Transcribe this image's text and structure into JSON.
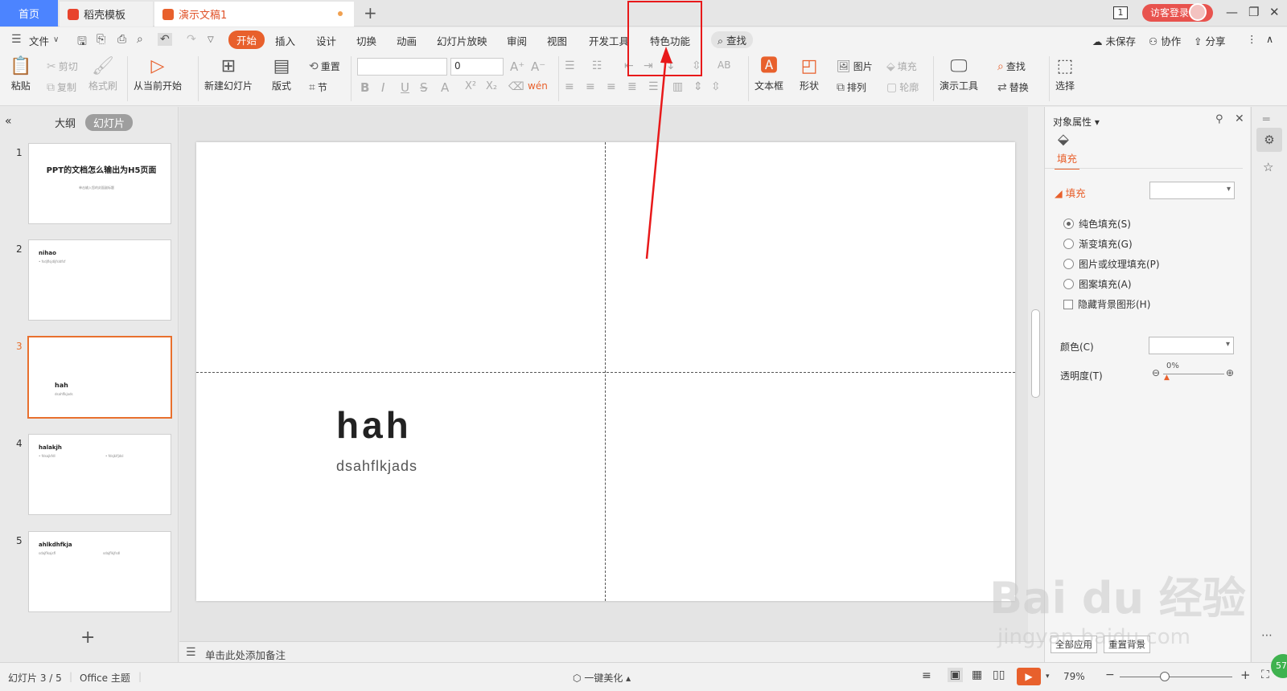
{
  "tabs": {
    "home": "首页",
    "template": "稻壳模板",
    "document": "演示文稿1",
    "new_tab": "+"
  },
  "window": {
    "slide_count_badge": "1",
    "login": "访客登录",
    "minimize": "—",
    "maximize": "❐",
    "close": "✕"
  },
  "menu": {
    "file": "文件",
    "items": [
      "开始",
      "插入",
      "设计",
      "切换",
      "动画",
      "幻灯片放映",
      "审阅",
      "视图",
      "开发工具",
      "特色功能"
    ],
    "active_index": 0,
    "search": "查找",
    "unsaved": "未保存",
    "collab": "协作",
    "share": "分享"
  },
  "ribbon": {
    "paste": "粘贴",
    "cut": "剪切",
    "copy": "复制",
    "format_painter": "格式刷",
    "from_current": "从当前开始",
    "new_slide": "新建幻灯片",
    "layout": "版式",
    "reset": "重置",
    "section": "节",
    "font_size_value": "0",
    "textbox": "文本框",
    "shape": "形状",
    "picture": "图片",
    "fill": "填充",
    "arrange": "排列",
    "outline": "轮廓",
    "present_tools": "演示工具",
    "find": "查找",
    "replace": "替换",
    "select": "选择"
  },
  "left_panel": {
    "tab_outline": "大纲",
    "tab_slides": "幻灯片",
    "slides": [
      {
        "num": "1",
        "title": "PPT的文档怎么输出为H5页面",
        "sub": "单击输入您的封面副标题"
      },
      {
        "num": "2",
        "title": "nihao",
        "sub": "• fsdjflsjdljfsldfsf"
      },
      {
        "num": "3",
        "title": "hah",
        "sub": "dsahflkjads"
      },
      {
        "num": "4",
        "title": "halakjh",
        "sub": "• fdsajkfdl",
        "sub2": "• fdsjklfjdsl"
      },
      {
        "num": "5",
        "title": "ahlkdhfkja",
        "sub": "sdajflkajsfl",
        "sub2": "sdajflkjfsdl"
      }
    ],
    "selected_index": 2,
    "add": "+"
  },
  "slide": {
    "title": "hah",
    "subtitle": "dsahflkjads"
  },
  "notes": {
    "placeholder": "单击此处添加备注"
  },
  "right_panel": {
    "header": "对象属性",
    "fill_tab": "填充",
    "fill_section": "填充",
    "options": [
      "纯色填充(S)",
      "渐变填充(G)",
      "图片或纹理填充(P)",
      "图案填充(A)"
    ],
    "selected_option": 0,
    "hide_bg": "隐藏背景图形(H)",
    "color_label": "颜色(C)",
    "transparency_label": "透明度(T)",
    "transparency_value": "0%",
    "apply_all": "全部应用",
    "reset_bg": "重置背景"
  },
  "status": {
    "slide_info": "幻灯片 3 / 5",
    "theme": "Office 主题",
    "beautify": "一键美化",
    "zoom": "79%"
  },
  "badge_green": "57",
  "watermark": {
    "brand": "Bai du 经验",
    "url": "jingyan.baidu.com"
  },
  "colors": {
    "accent": "#e8602c",
    "home_tab": "#4c84ff",
    "highlight_box": "#e8191a",
    "arrow": "#e8191a"
  }
}
